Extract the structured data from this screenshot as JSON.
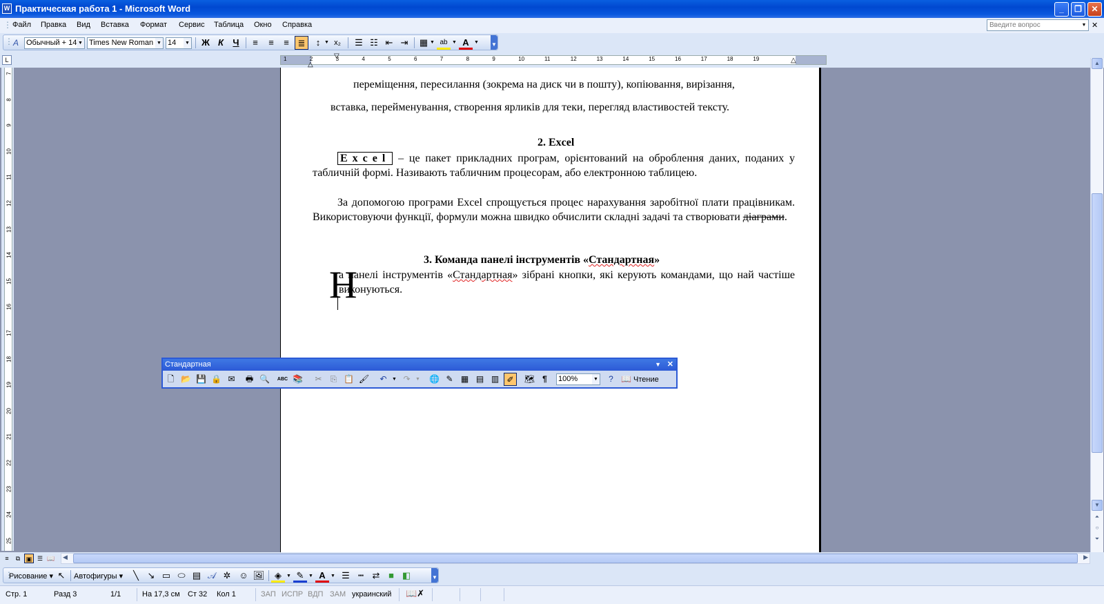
{
  "window": {
    "title": "Практическая работа 1 - Microsoft Word",
    "app_icon": "W"
  },
  "menu": {
    "items": [
      "Файл",
      "Правка",
      "Вид",
      "Вставка",
      "Формат",
      "Сервис",
      "Таблица",
      "Окно",
      "Справка"
    ],
    "ask_placeholder": "Введите вопрос"
  },
  "format_toolbar": {
    "style": "Обычный + 14",
    "font": "Times New Roman",
    "size": "14",
    "bold": "Ж",
    "italic": "К",
    "underline": "Ч",
    "subscript": "x₂",
    "text_color": "A",
    "highlight": "ab"
  },
  "ruler": {
    "marks": [
      "1",
      "2",
      "3",
      "4",
      "5",
      "6",
      "7",
      "8",
      "9",
      "10",
      "11",
      "12",
      "13",
      "14",
      "15",
      "16",
      "17",
      "18",
      "19"
    ]
  },
  "vruler": {
    "marks": [
      "7",
      "8",
      "9",
      "10",
      "11",
      "12",
      "13",
      "14",
      "15",
      "16",
      "17",
      "18",
      "19",
      "20",
      "21",
      "22",
      "23",
      "24",
      "25"
    ]
  },
  "document": {
    "line1": "переміщення, пересилання (зокрема на диск чи в пошту), копіювання, вирізання,",
    "line2": "вставка, перейменування, створення ярликів для теки, перегляд властивостей тексту.",
    "heading2": "2.  Excel",
    "p1_term": "Excel",
    "p1_rest": "– це пакет прикладних програм, орієнтований на оброблення даних, поданих у табличній формі. Називають табличним процесорам, або електронною таблицею.",
    "p2_main": "За допомогою програми Excel спрощується процес нарахування заробітної плати працівникам. Використовуючи функції, формули можна швидко обчислити складні задачі та створювати",
    "p2_strike": "діаграми",
    "p2_end": ".",
    "heading3_pre": "3.  Команда панелі інструментів «",
    "heading3_word": "Стандартная",
    "heading3_post": "»",
    "dropcap": "Н",
    "p3_pre": "а панелі інструментів «",
    "p3_word": "Стандартная",
    "p3_post": "» зібрані кнопки, які керують командами, що най частіше виконуються."
  },
  "standard_toolbar": {
    "title": "Стандартная",
    "zoom": "100%",
    "reading_label": "Чтение",
    "spelling_label": "ABC"
  },
  "draw_toolbar": {
    "drawing": "Рисование",
    "autoshapes": "Автофигуры"
  },
  "status": {
    "page": "Стр. 1",
    "section": "Разд 3",
    "pages": "1/1",
    "at": "На 17,3 см",
    "line": "Ст 32",
    "col": "Кол 1",
    "rec": "ЗАП",
    "trk": "ИСПР",
    "ext": "ВДП",
    "ovr": "ЗАМ",
    "lang": "украинский"
  }
}
